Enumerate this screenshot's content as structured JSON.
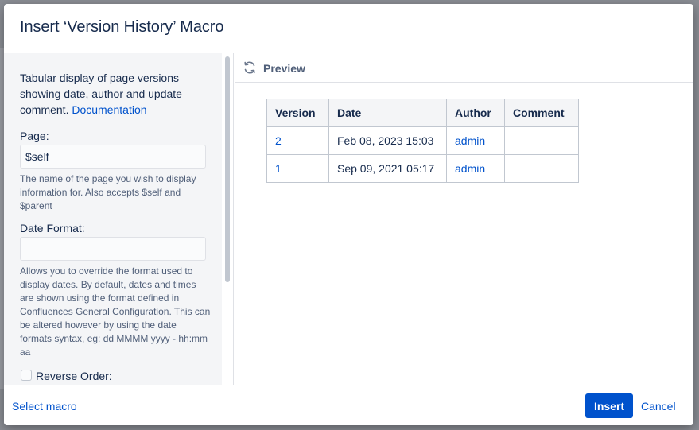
{
  "dialog": {
    "title": "Insert ‘Version History’ Macro"
  },
  "sidebar": {
    "description": "Tabular display of page versions showing date, author and update comment.",
    "documentation_link": "Documentation",
    "page_field": {
      "label": "Page:",
      "value": "$self",
      "help": "The name of the page you wish to display information for. Also accepts $self and $parent"
    },
    "date_format_field": {
      "label": "Date Format:",
      "value": "",
      "help": "Allows you to override the format used to display dates. By default, dates and times are shown using the format defined in Confluences General Configuration. This can be altered however by using the date formats syntax, eg: dd MMMM yyyy - hh:mm aa"
    },
    "reverse_order": {
      "label": "Reverse Order:",
      "checked": false
    }
  },
  "preview": {
    "label": "Preview",
    "icon": "refresh-icon",
    "table": {
      "headers": [
        "Version",
        "Date",
        "Author",
        "Comment"
      ],
      "rows": [
        {
          "version": "2",
          "date": "Feb 08, 2023 15:03",
          "author": "admin",
          "comment": ""
        },
        {
          "version": "1",
          "date": "Sep 09, 2021 05:17",
          "author": "admin",
          "comment": ""
        }
      ]
    }
  },
  "footer": {
    "select_macro": "Select macro",
    "insert": "Insert",
    "cancel": "Cancel"
  },
  "colors": {
    "primary": "#0052cc",
    "link": "#0052cc",
    "text": "#172b4d",
    "muted": "#505f79",
    "border": "#dfe1e6"
  }
}
